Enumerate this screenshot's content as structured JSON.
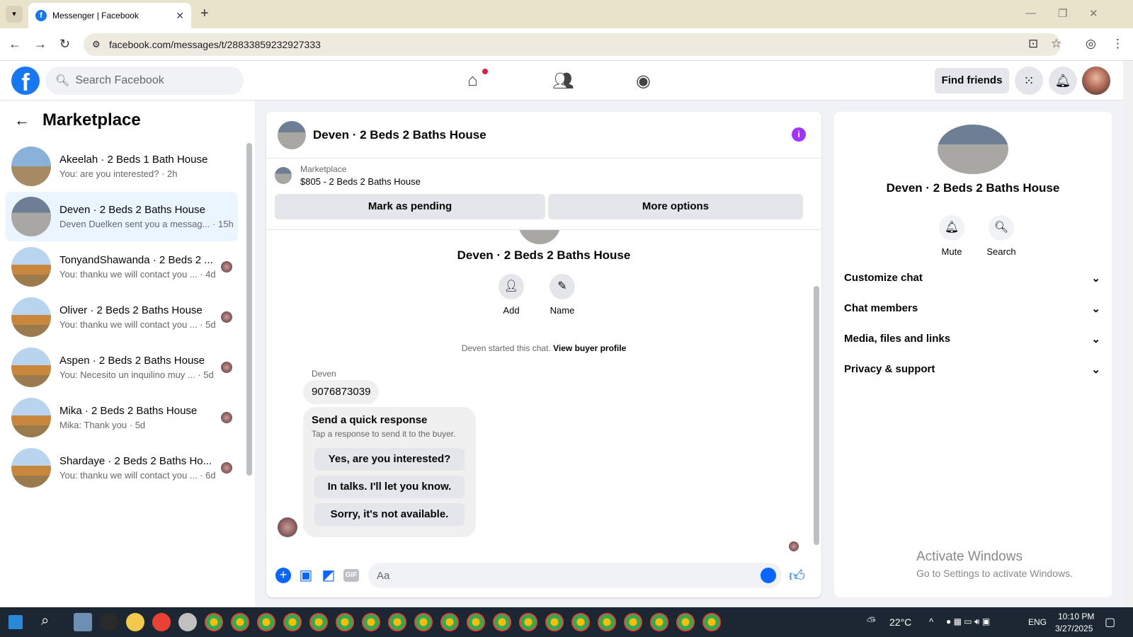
{
  "browser": {
    "tab_title": "Messenger | Facebook",
    "url": "facebook.com/messages/t/28833859232927333"
  },
  "fb": {
    "logo": "f",
    "search_placeholder": "Search Facebook",
    "find_friends": "Find friends"
  },
  "left": {
    "title": "Marketplace",
    "conversations": [
      {
        "title": "Akeelah · 2 Beds 1 Bath House",
        "subtitle": "You: are you interested? · 2h",
        "thumb": "ruin"
      },
      {
        "title": "Deven · 2 Beds 2 Baths House",
        "subtitle": "Deven Duelken sent you a messag... · 15h",
        "thumb": "deven",
        "active": true
      },
      {
        "title": "TonyandShawanda · 2 Beds 2 ...",
        "subtitle": "You: thanku we will contact you ... · 4d",
        "thumb": "house"
      },
      {
        "title": "Oliver · 2 Beds 2 Baths House",
        "subtitle": "You: thanku we will contact you ... · 5d",
        "thumb": "house"
      },
      {
        "title": "Aspen · 2 Beds 2 Baths House",
        "subtitle": "You: Necesito un inquilino muy ... · 5d",
        "thumb": "house"
      },
      {
        "title": "Mika · 2 Beds 2 Baths House",
        "subtitle": "Mika: Thank you · 5d",
        "thumb": "house"
      },
      {
        "title": "Shardaye · 2 Beds 2 Baths Ho...",
        "subtitle": "You: thanku we will contact you ... · 6d",
        "thumb": "house"
      }
    ]
  },
  "chat": {
    "title": "Deven · 2 Beds 2 Baths House",
    "marketplace_label": "Marketplace",
    "listing": "$805 - 2 Beds 2 Baths House",
    "mark_pending": "Mark as pending",
    "more_options": "More options",
    "name_center": "Deven · 2 Beds 2 Baths House",
    "add_label": "Add",
    "name_label": "Name",
    "started_text": "Deven started this chat.",
    "view_buyer": "View buyer profile",
    "sender": "Deven",
    "message": "9076873039",
    "quick_title": "Send a quick response",
    "quick_sub": "Tap a response to send it to the buyer.",
    "quick_options": [
      "Yes, are you interested?",
      "In talks. I'll let you know.",
      "Sorry, it's not available."
    ],
    "composer_placeholder": "Aa"
  },
  "right": {
    "name": "Deven · 2 Beds 2 Baths House",
    "mute": "Mute",
    "search": "Search",
    "sections": [
      "Customize chat",
      "Chat members",
      "Media, files and links",
      "Privacy & support"
    ]
  },
  "watermark": {
    "line1": "Activate Windows",
    "line2": "Go to Settings to activate Windows."
  },
  "taskbar": {
    "temp": "22°C",
    "lang": "ENG",
    "time": "10:10 PM",
    "date": "3/27/2025"
  }
}
